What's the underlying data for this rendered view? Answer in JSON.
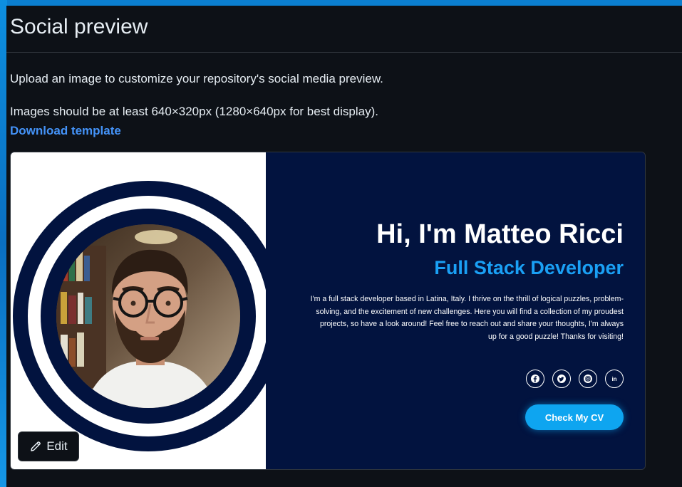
{
  "section": {
    "title": "Social preview",
    "description": "Upload an image to customize your repository's social media preview.",
    "requirements": "Images should be at least 640×320px (1280×640px for best display).",
    "download_link": "Download template"
  },
  "preview_image": {
    "name": "Hi, I'm Matteo Ricci",
    "role": "Full Stack Developer",
    "bio": "I'm a full stack developer based in Latina, Italy. I thrive on the thrill of logical puzzles, problem-solving, and the excitement of new challenges. Here you will find a collection of my proudest projects, so have a look around! Feel free to reach out and share your thoughts, I'm always up for a good puzzle! Thanks for visiting!",
    "cta_label": "Check My CV",
    "social_icons": [
      "facebook-icon",
      "twitter-icon",
      "instagram-icon",
      "linkedin-icon"
    ],
    "colors": {
      "navy": "#02133f",
      "accent": "#1aa0f5",
      "button": "#0ea5f0"
    }
  },
  "edit_button": {
    "label": "Edit",
    "icon": "pencil-icon"
  },
  "theme": {
    "background": "#0d1117",
    "text": "#e6edf3",
    "link": "#4493f8",
    "border": "#30363d"
  }
}
